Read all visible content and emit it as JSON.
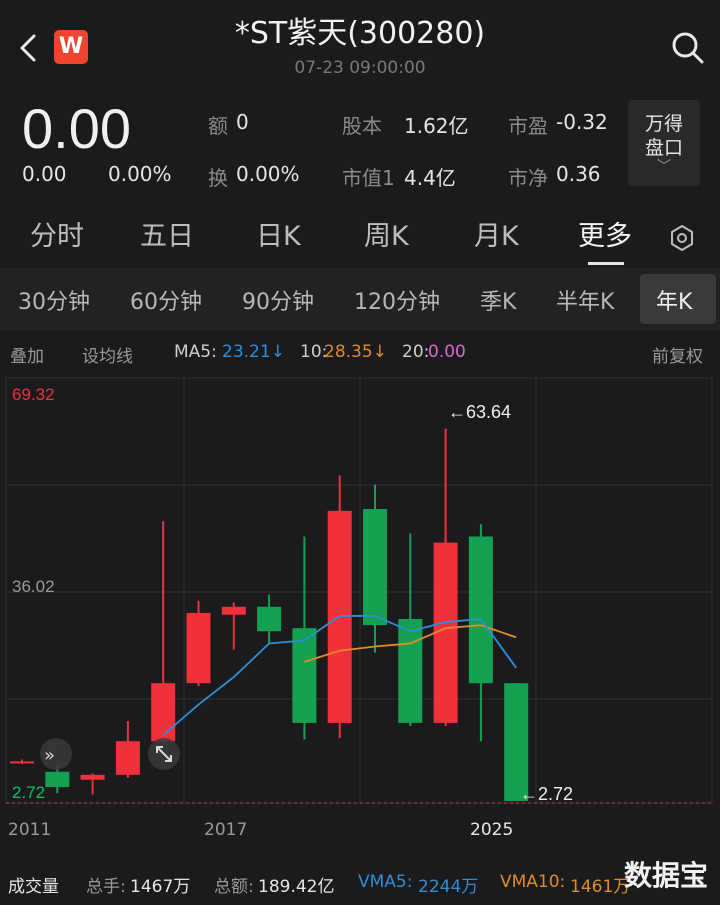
{
  "header": {
    "title": "*ST紫天(300280)",
    "time": "07-23 09:00:00",
    "logo_letter": "W"
  },
  "quote": {
    "price": "0.00",
    "change": "0.00",
    "change_pct": "0.00%",
    "fields": [
      {
        "label": "额",
        "value": "0"
      },
      {
        "label": "股本",
        "value": "1.62亿"
      },
      {
        "label": "市盈",
        "value": "-0.32"
      },
      {
        "label": "换",
        "value": "0.00%"
      },
      {
        "label": "市值1",
        "value": "4.4亿"
      },
      {
        "label": "市净",
        "value": "0.36"
      }
    ],
    "wande_line1": "万得",
    "wande_line2": "盘口",
    "wande_chevron": "﹀"
  },
  "period_tabs": [
    "分时",
    "五日",
    "日K",
    "周K",
    "月K",
    "更多"
  ],
  "period_active": "更多",
  "minute_tabs": [
    "30分钟",
    "60分钟",
    "90分钟",
    "120分钟",
    "季K",
    "半年K",
    "年K"
  ],
  "minute_active": "年K",
  "ma_row": {
    "overlay": "叠加",
    "set_ma": "设均线",
    "ma5_label": "MA5:",
    "ma5_value": "23.21↓",
    "ma10_label": "10:",
    "ma10_value": "28.35↓",
    "ma20_label": "20:",
    "ma20_value": "0.00",
    "adjust": "前复权"
  },
  "colors": {
    "up": "#f0313c",
    "down": "#15a052",
    "ma5": "#2f8fd6",
    "ma10": "#e08a2a",
    "ma20": "#d96ad3",
    "grid": "#303034"
  },
  "chart_data": {
    "type": "candlestick",
    "y_labels": {
      "top": "69.32",
      "mid": "36.02",
      "bottom": "2.72"
    },
    "ylim": [
      2.72,
      69.32
    ],
    "x_ticks": [
      "2011",
      "2017",
      "2025"
    ],
    "annotations": {
      "high": "←63.64",
      "low": "←2.72"
    },
    "candles": [
      {
        "year": 2011,
        "open": 9.0,
        "close": 9.2,
        "high": 9.5,
        "low": 8.8
      },
      {
        "year": 2012,
        "open": 7.5,
        "close": 5.0,
        "high": 8.5,
        "low": 4.0
      },
      {
        "year": 2013,
        "open": 6.2,
        "close": 7.0,
        "high": 7.2,
        "low": 3.8
      },
      {
        "year": 2014,
        "open": 7.0,
        "close": 12.5,
        "high": 15.8,
        "low": 6.5
      },
      {
        "year": 2015,
        "open": 12.5,
        "close": 22.0,
        "high": 48.5,
        "low": 12.0
      },
      {
        "year": 2016,
        "open": 22.0,
        "close": 33.5,
        "high": 35.5,
        "low": 21.5
      },
      {
        "year": 2017,
        "open": 33.2,
        "close": 34.5,
        "high": 35.2,
        "low": 27.5
      },
      {
        "year": 2018,
        "open": 34.5,
        "close": 30.5,
        "high": 36.5,
        "low": 28.5
      },
      {
        "year": 2019,
        "open": 31.0,
        "close": 15.5,
        "high": 46.0,
        "low": 12.8
      },
      {
        "year": 2020,
        "open": 15.5,
        "close": 50.2,
        "high": 56.0,
        "low": 13.0
      },
      {
        "year": 2021,
        "open": 50.5,
        "close": 31.5,
        "high": 54.5,
        "low": 27.0
      },
      {
        "year": 2022,
        "open": 32.5,
        "close": 15.5,
        "high": 46.5,
        "low": 15.0
      },
      {
        "year": 2023,
        "open": 15.5,
        "close": 45.0,
        "high": 63.64,
        "low": 15.0
      },
      {
        "year": 2024,
        "open": 46.0,
        "close": 22.0,
        "high": 48.0,
        "low": 12.5
      },
      {
        "year": 2025,
        "open": 22.0,
        "close": 2.72,
        "high": 22.0,
        "low": 2.72
      }
    ],
    "ma5": [
      [
        2015,
        13.5
      ],
      [
        2016,
        18.5
      ],
      [
        2017,
        23.0
      ],
      [
        2018,
        28.5
      ],
      [
        2019,
        29.0
      ],
      [
        2020,
        33.0
      ],
      [
        2021,
        33.0
      ],
      [
        2022,
        30.5
      ],
      [
        2023,
        32.0
      ],
      [
        2024,
        32.5
      ],
      [
        2025,
        24.5
      ]
    ],
    "ma10": [
      [
        2019,
        25.5
      ],
      [
        2020,
        27.3
      ],
      [
        2021,
        28.0
      ],
      [
        2022,
        28.5
      ],
      [
        2023,
        31.0
      ],
      [
        2024,
        31.5
      ],
      [
        2025,
        29.5
      ]
    ]
  },
  "volume_row": {
    "title": "成交量",
    "total_hands_label": "总手:",
    "total_hands_value": "1467万",
    "total_amount_label": "总额:",
    "total_amount_value": "189.42亿",
    "vma5_label": "VMA5:",
    "vma5_value": "2244万",
    "vma10_label": "VMA10:",
    "vma10_value": "1461万"
  },
  "watermark": "数据宝"
}
